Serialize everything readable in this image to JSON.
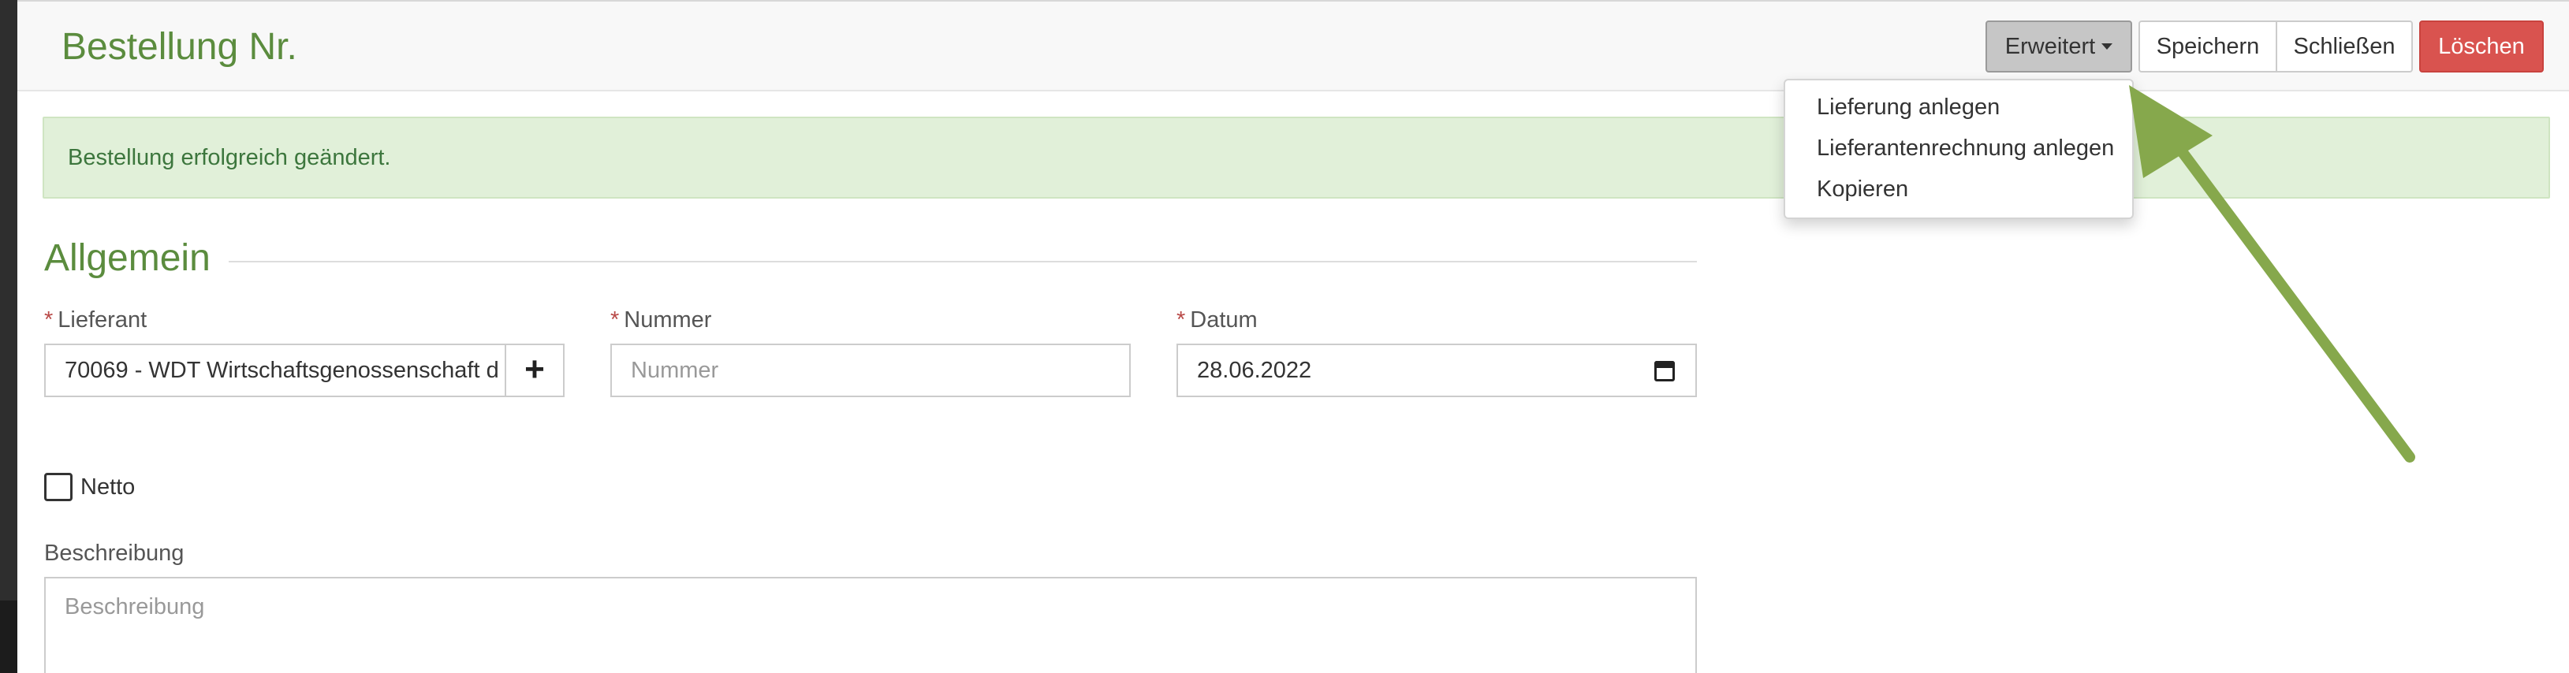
{
  "header": {
    "title": "Bestellung Nr.",
    "buttons": {
      "erweitert": "Erweitert",
      "speichern": "Speichern",
      "schliessen": "Schließen",
      "loeschen": "Löschen"
    }
  },
  "dropdown": {
    "items": [
      "Lieferung anlegen",
      "Lieferantenrechnung anlegen",
      "Kopieren"
    ]
  },
  "alert": {
    "text": "Bestellung erfolgreich geändert."
  },
  "section": {
    "title": "Allgemein"
  },
  "form": {
    "required_mark": "*",
    "lieferant": {
      "label": "Lieferant",
      "value": "70069 - WDT Wirtschaftsgenossenschaft d",
      "add_symbol": "+"
    },
    "nummer": {
      "label": "Nummer",
      "placeholder": "Nummer"
    },
    "datum": {
      "label": "Datum",
      "value": "28.06.2022"
    },
    "netto": {
      "label": "Netto",
      "checked": false
    },
    "beschreibung": {
      "label": "Beschreibung",
      "placeholder": "Beschreibung"
    }
  },
  "colors": {
    "brand_green": "#5b8c3e",
    "danger": "#d9534f",
    "success_bg": "#e1f0d9",
    "annotation_arrow": "#86a84c"
  },
  "icons": {
    "add": "plus-icon",
    "calendar": "calendar-icon",
    "caret": "caret-down-icon"
  }
}
